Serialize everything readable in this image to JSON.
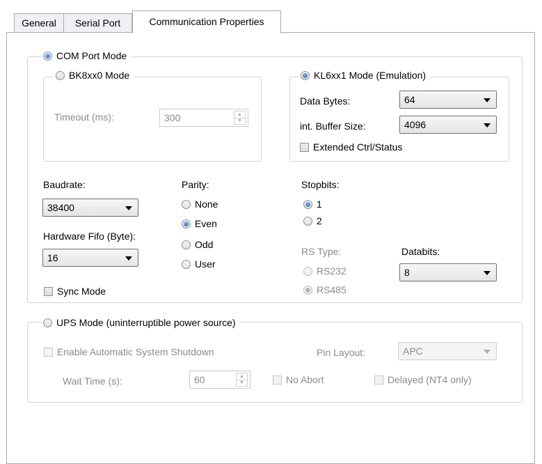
{
  "tabs": [
    "General",
    "Serial Port",
    "Communication Properties"
  ],
  "com_port_mode": {
    "label": "COM Port Mode",
    "bk_mode": {
      "label": "BK8xx0 Mode",
      "timeout_label": "Timeout (ms):",
      "timeout_value": "300"
    },
    "kl_mode": {
      "label": "KL6xx1 Mode (Emulation)",
      "data_bytes_label": "Data Bytes:",
      "data_bytes_value": "64",
      "buffer_label": "int. Buffer Size:",
      "buffer_value": "4096",
      "extended_label": "Extended Ctrl/Status"
    },
    "baudrate_label": "Baudrate:",
    "baudrate_value": "38400",
    "fifo_label": "Hardware Fifo (Byte):",
    "fifo_value": "16",
    "sync_label": "Sync Mode",
    "parity_label": "Parity:",
    "parity_options": [
      "None",
      "Even",
      "Odd",
      "User"
    ],
    "stopbits_label": "Stopbits:",
    "stopbits_options": [
      "1",
      "2"
    ],
    "rs_type_label": "RS Type:",
    "rs_type_options": [
      "RS232",
      "RS485"
    ],
    "databits_label": "Databits:",
    "databits_value": "8"
  },
  "ups_mode": {
    "label": "UPS Mode (uninterruptible power source)",
    "shutdown_label": "Enable Automatic System Shutdown",
    "pin_layout_label": "Pin Layout:",
    "pin_layout_value": "APC",
    "wait_label": "Wait Time (s):",
    "wait_value": "60",
    "no_abort_label": "No Abort",
    "delayed_label": "Delayed (NT4 only)"
  }
}
